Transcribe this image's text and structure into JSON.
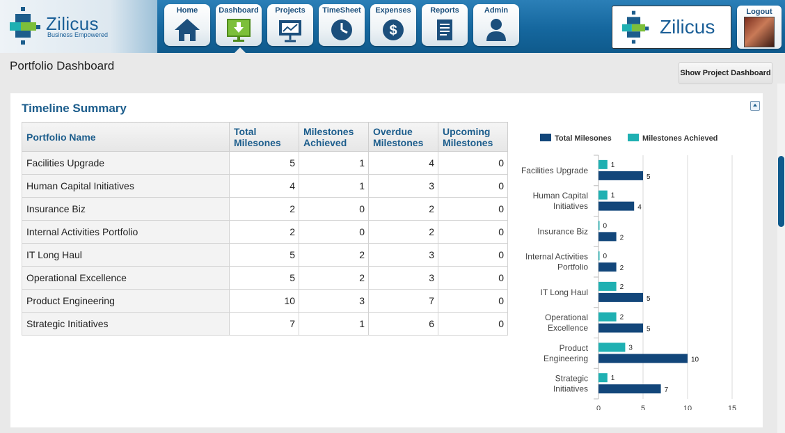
{
  "header": {
    "logo_text": "Zilicus",
    "logo_tagline": "Business Empowered",
    "brand_text": "Zilicus",
    "logout_label": "Logout"
  },
  "nav": [
    {
      "label": "Home",
      "icon": "home-icon"
    },
    {
      "label": "Dashboard",
      "icon": "dashboard-icon",
      "active": true
    },
    {
      "label": "Projects",
      "icon": "projects-icon"
    },
    {
      "label": "TimeSheet",
      "icon": "clock-icon"
    },
    {
      "label": "Expenses",
      "icon": "dollar-icon"
    },
    {
      "label": "Reports",
      "icon": "report-icon"
    },
    {
      "label": "Admin",
      "icon": "user-icon"
    }
  ],
  "page": {
    "title": "Portfolio Dashboard",
    "show_project_button": "Show Project Dashboard"
  },
  "panel": {
    "title": "Timeline Summary"
  },
  "table": {
    "headers": [
      "Portfolio Name",
      "Total Milesones",
      "Milestones Achieved",
      "Overdue Milestones",
      "Upcoming Milestones"
    ],
    "rows": [
      [
        "Facilities Upgrade",
        "5",
        "1",
        "4",
        "0"
      ],
      [
        "Human Capital Initiatives",
        "4",
        "1",
        "3",
        "0"
      ],
      [
        "Insurance Biz",
        "2",
        "0",
        "2",
        "0"
      ],
      [
        "Internal Activities Portfolio",
        "2",
        "0",
        "2",
        "0"
      ],
      [
        "IT Long Haul",
        "5",
        "2",
        "3",
        "0"
      ],
      [
        "Operational Excellence",
        "5",
        "2",
        "3",
        "0"
      ],
      [
        "Product Engineering",
        "10",
        "3",
        "7",
        "0"
      ],
      [
        "Strategic Initiatives",
        "7",
        "1",
        "6",
        "0"
      ]
    ]
  },
  "colors": {
    "total": "#12467a",
    "achieved": "#1fb0b2",
    "accent": "#1c5d8c"
  },
  "chart_data": {
    "type": "bar",
    "orientation": "horizontal",
    "categories": [
      [
        "Facilities Upgrade"
      ],
      [
        "Human Capital",
        "Initiatives"
      ],
      [
        "Insurance Biz"
      ],
      [
        "Internal Activities",
        "Portfolio"
      ],
      [
        "IT Long Haul"
      ],
      [
        "Operational",
        "Excellence"
      ],
      [
        "Product",
        "Engineering"
      ],
      [
        "Strategic",
        "Initiatives"
      ]
    ],
    "series": [
      {
        "name": "Total Milesones",
        "values": [
          5,
          4,
          2,
          2,
          5,
          5,
          10,
          7
        ]
      },
      {
        "name": "Milestones Achieved",
        "values": [
          1,
          1,
          0,
          0,
          2,
          2,
          3,
          1
        ]
      }
    ],
    "xlim": [
      0,
      15
    ],
    "xticks": [
      0,
      5,
      10,
      15
    ],
    "legend_position": "top",
    "grid": true
  }
}
